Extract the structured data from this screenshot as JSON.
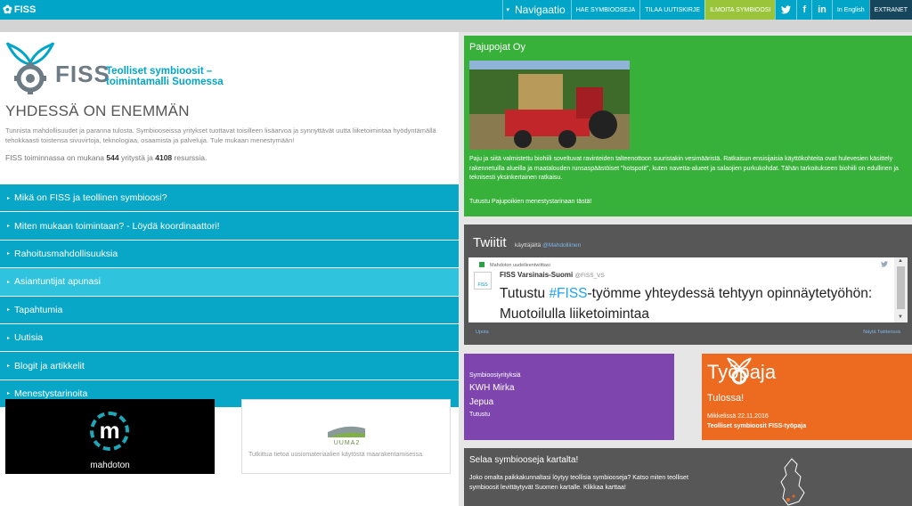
{
  "topbar": {
    "logo": "FISS",
    "nav": {
      "navigation": "Navigaatio",
      "search": "HAE SYMBIOOSEJA",
      "newsletter": "TILAA UUTISKIRJE",
      "report": "ILMOITA SYMBIOOSI",
      "language": "In English",
      "extranet": "EXTRANET"
    },
    "social": [
      "twitter-icon",
      "facebook-icon",
      "linkedin-icon"
    ]
  },
  "brand": {
    "name": "FISS",
    "tagline_1": "Teolliset symbioosit –",
    "tagline_2": "toimintamalli Suomessa"
  },
  "intro": {
    "headline": "YHDESSÄ ON ENEMMÄN",
    "text": "Tunnista mahdollisuudet ja paranna tulosta. Symbiooseissa yritykset tuottavat toisilleen lisäarvoa ja synnyttävät uutta liiketoimintaa hyödyntämällä tehokkaasti toistensa sivuvirtoja, teknologiaa, osaamista ja palveluja. Tule mukaan menestymään!",
    "count_prefix": "FISS toiminnassa on mukana",
    "companies": "544",
    "count_mid": "yritystä ja",
    "resources": "4108",
    "count_suffix": "resurssia."
  },
  "menu": [
    "Mikä on FISS ja teollinen symbioosi?",
    "Miten mukaan toimintaan? - Löydä koordinaattori!",
    "Rahoitusmahdollisuuksia",
    "Asiantuntijat apunasi",
    "Tapahtumia",
    "Uutisia",
    "Blogit ja artikkelit",
    "Menestystarinoita"
  ],
  "tiles": {
    "m_name": "mahdoton",
    "uuma_name": "UUMA2",
    "uuma_desc": "Tutkittua tietoa uusiomateriaalien käytöstä maarakentamisessa."
  },
  "story": {
    "title": "Pajupojat Oy",
    "text": "Paju ja siitä valmistettu biohiili soveltuvat ravinteiden talteenottoon suuristakin vesimääristä. Ratkaisun ensisijaisia käyttökohteita ovat hulevesien käsittely rakennetuilla alueilla ja maatalouden runsaspäästöiset \"hotspotit\", kuten navetta-alueet ja salaojien purkukohdat. Tähän tarkoitukseen  biohiili on edullinen ja teknisesti yksinkertainen ratkaisu.",
    "more": "Tutustu Pajupoikien menestystarinaan tästä!"
  },
  "twitter": {
    "title": "Twiitit",
    "by_prefix": "käyttäjältä",
    "by_handle": "@Mahdolliinen",
    "retweet": "Mahdoton uudelleentwiittasi",
    "avatar": "FISS",
    "name": "FISS Varsinais-Suomi",
    "handle": "@FISS_VS",
    "tweet_pre": "Tutustu ",
    "tweet_hash": "#FISS",
    "tweet_post": "-työmme yhteydessä tehtyyn opinnäytetyöhön: Muotoilulla liiketoimintaa",
    "embed": "Upota",
    "view": "Näytä Twitterissä"
  },
  "companies": {
    "label": "Symbioosiyrityksiä",
    "c1": "KWH Mirka",
    "c2": "Jepua",
    "more": "Tutustu"
  },
  "workshop": {
    "title": "Työpaja",
    "subtitle": "Tulossa!",
    "date": "Mikkelissä 22.11.2016",
    "event": "Teolliset symbioosit FISS-työpaja"
  },
  "map": {
    "title": "Selaa symbiooseja kartalta!",
    "text": "Joko omalta paikkakunnaltasi löytyy teollisia symbiooseja? Katso miten teolliset symbioosit levittäytyvät Suomen kartalle. Klikkaa karttaa!"
  },
  "colors": {
    "primary": "#00a5c8",
    "menu": "#08a6c7",
    "menu_highlight": "#2fc3de",
    "report": "#9ac43a",
    "extranet": "#15465c",
    "story": "#37b13a",
    "twitter_bg": "#575757",
    "companies": "#7d45ad",
    "workshop": "#ec6b20"
  }
}
